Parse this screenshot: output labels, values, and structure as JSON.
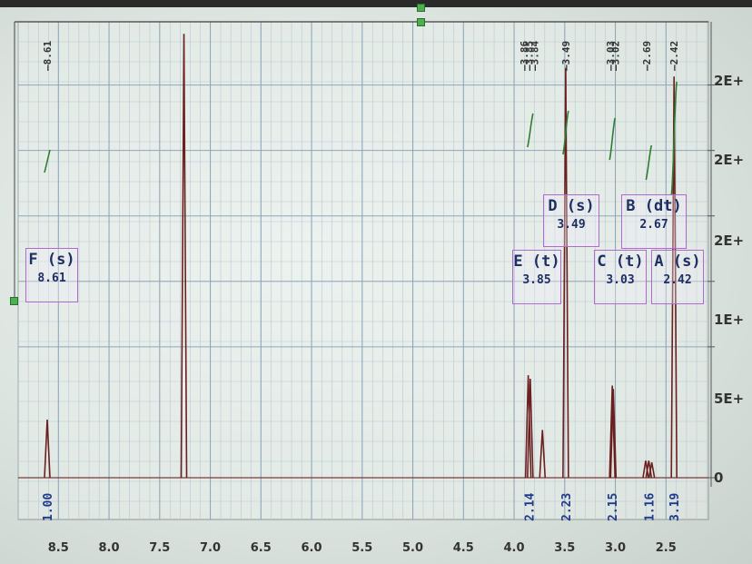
{
  "chart_data": {
    "type": "nmr-spectrum",
    "x_axis": {
      "reversed": true,
      "range": [
        8.85,
        2.15
      ],
      "tick_labels": [
        "8.5",
        "8.0",
        "7.5",
        "7.0",
        "6.5",
        "6.0",
        "5.5",
        "5.0",
        "4.5",
        "4.0",
        "3.5",
        "3.0",
        "2.5"
      ],
      "tick_values": [
        8.5,
        8.0,
        7.5,
        7.0,
        6.5,
        6.0,
        5.5,
        5.0,
        4.5,
        4.0,
        3.5,
        3.0,
        2.5
      ]
    },
    "y_axis": {
      "tick_labels": [
        "2E+",
        "2E+",
        "2E+",
        "1E+",
        "5E+",
        "0"
      ],
      "tick_values": [
        2.4,
        2.0,
        1.6,
        1.2,
        0.8,
        0
      ]
    },
    "grid": true,
    "peaks": [
      {
        "x": 8.61,
        "h": 0.34
      },
      {
        "x": 7.26,
        "h": 2.6
      },
      {
        "x": 3.86,
        "h": 0.6
      },
      {
        "x": 3.84,
        "h": 0.58
      },
      {
        "x": 3.72,
        "h": 0.28
      },
      {
        "x": 3.49,
        "h": 2.4
      },
      {
        "x": 3.03,
        "h": 0.54
      },
      {
        "x": 3.02,
        "h": 0.52
      },
      {
        "x": 2.7,
        "h": 0.1
      },
      {
        "x": 2.67,
        "h": 0.1
      },
      {
        "x": 2.64,
        "h": 0.09
      },
      {
        "x": 2.42,
        "h": 2.35
      }
    ],
    "peak_annotations": [
      "8.61",
      "3.86",
      "3.85",
      "3.84",
      "3.49",
      "3.03",
      "3.02",
      "2.69",
      "2.42"
    ],
    "integrals": [
      "1.00",
      "2.14",
      "2.23",
      "2.15",
      "1.16",
      "3.19"
    ],
    "multiplets": [
      {
        "name": "F (s)",
        "shift": "8.61"
      },
      {
        "name": "E (t)",
        "shift": "3.85"
      },
      {
        "name": "D (s)",
        "shift": "3.49"
      },
      {
        "name": "C (t)",
        "shift": "3.03"
      },
      {
        "name": "B (dt)",
        "shift": "2.67"
      },
      {
        "name": "A (s)",
        "shift": "2.42"
      }
    ]
  }
}
